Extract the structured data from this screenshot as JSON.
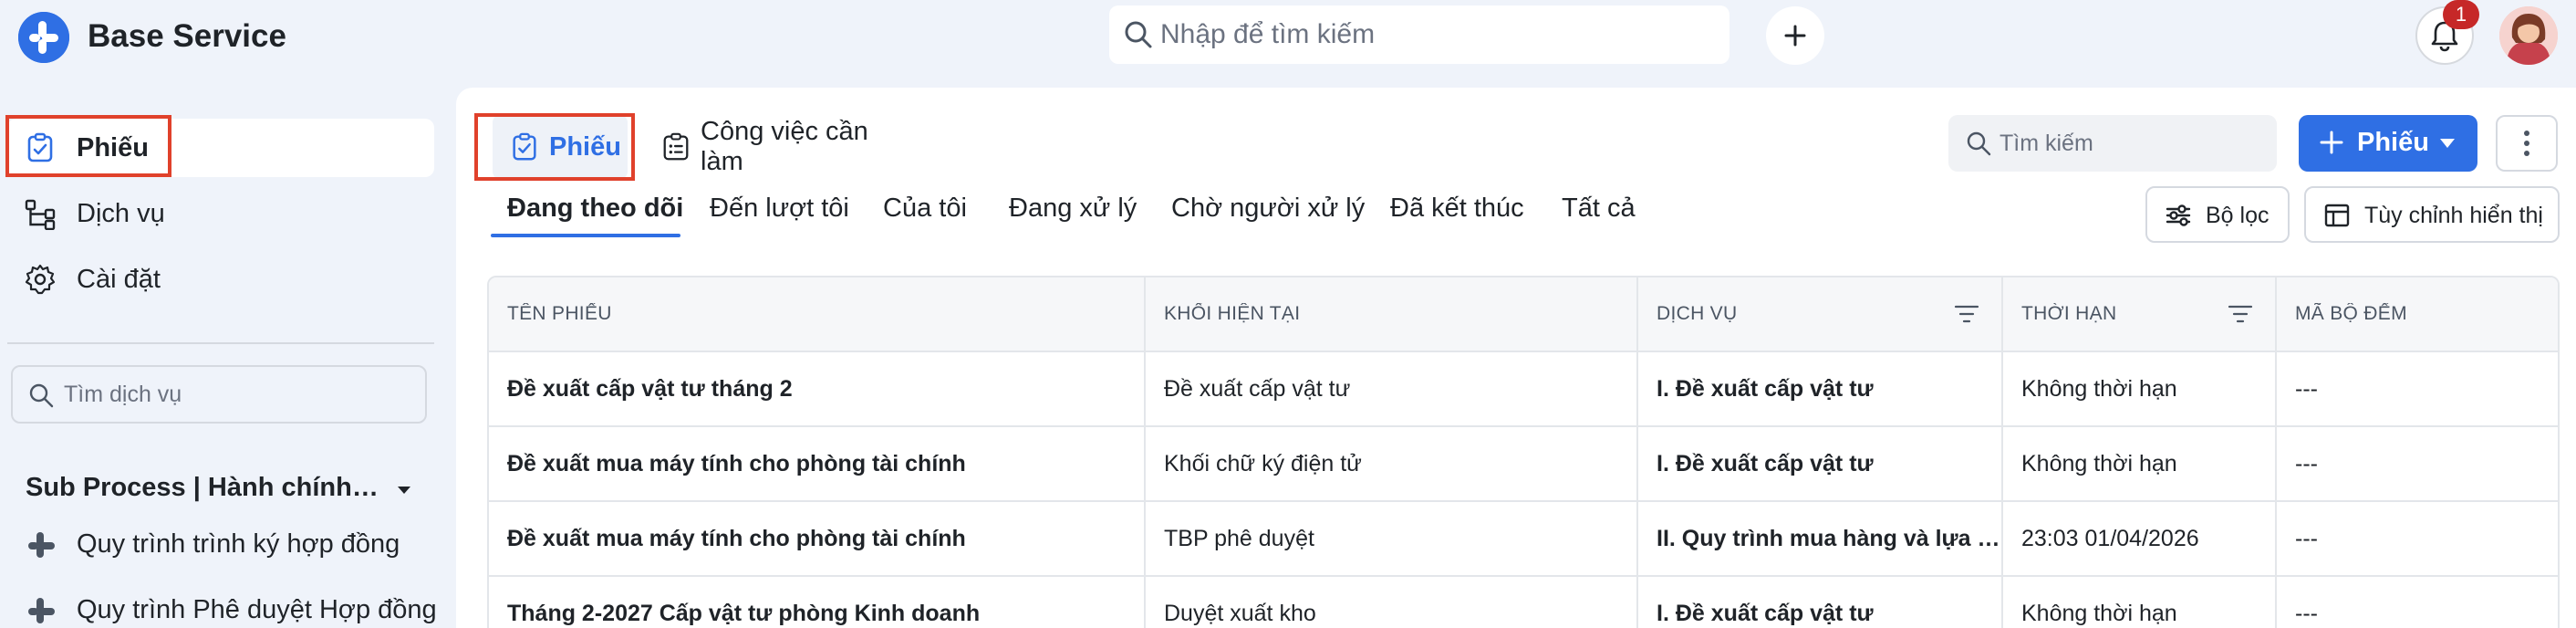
{
  "app": {
    "title": "Base Service",
    "search_placeholder": "Nhập để tìm kiếm",
    "notification_count": "1",
    "brand_color": "#2f6fe4"
  },
  "sidebar": {
    "nav": [
      {
        "label": "Phiếu",
        "icon": "ticket-check-icon",
        "active": true
      },
      {
        "label": "Dịch vụ",
        "icon": "workflow-icon",
        "active": false
      },
      {
        "label": "Cài đặt",
        "icon": "gear-icon",
        "active": false
      }
    ],
    "search_placeholder": "Tìm dịch vụ",
    "group_title": "Sub Process | Hành chính nhân sự",
    "processes": [
      {
        "label": "Quy trình trình ký hợp đồng",
        "icon": "process-icon"
      },
      {
        "label": "Quy trình Phê duyệt Hợp đồng",
        "icon": "process-icon"
      }
    ]
  },
  "main": {
    "tabs": [
      {
        "label": "Phiếu",
        "icon": "ticket-check-icon",
        "active": true
      },
      {
        "label": "Công việc cần làm",
        "icon": "task-list-icon",
        "active": false
      }
    ],
    "search_placeholder": "Tìm kiếm",
    "primary_button_label": "Phiếu",
    "filter_tabs": [
      "Đang theo dõi",
      "Đến lượt tôi",
      "Của tôi",
      "Đang xử lý",
      "Chờ người xử lý",
      "Đã kết thúc",
      "Tất cả"
    ],
    "active_filter_tab": "Đang theo dõi",
    "filter_button_label": "Bộ lọc",
    "customize_button_label": "Tùy chỉnh hiển thị"
  },
  "table": {
    "columns": [
      "TÊN PHIẾU",
      "KHỐI HIỆN TẠI",
      "DỊCH VỤ",
      "THỜI HẠN",
      "MÃ BỘ ĐẾM"
    ],
    "rows": [
      [
        "Đề xuất cấp vật tư tháng 2",
        "Đề xuất cấp vật tư",
        "I. Đề xuất cấp vật tư",
        "Không thời hạn",
        "---"
      ],
      [
        "Đề xuất mua máy tính cho phòng tài chính",
        "Khối chữ ký điện tử",
        "I. Đề xuất cấp vật tư",
        "Không thời hạn",
        "---"
      ],
      [
        "Đề xuất mua máy tính cho phòng tài chính",
        "TBP phê duyệt",
        "II. Quy trình mua hàng và lựa chọn nhà cung cấp",
        "23:03 01/04/2026",
        "---"
      ],
      [
        "Tháng 2-2027 Cấp vật tư phòng Kinh doanh",
        "Duyệt xuất kho",
        "I. Đề xuất cấp vật tư",
        "Không thời hạn",
        "---"
      ]
    ]
  }
}
